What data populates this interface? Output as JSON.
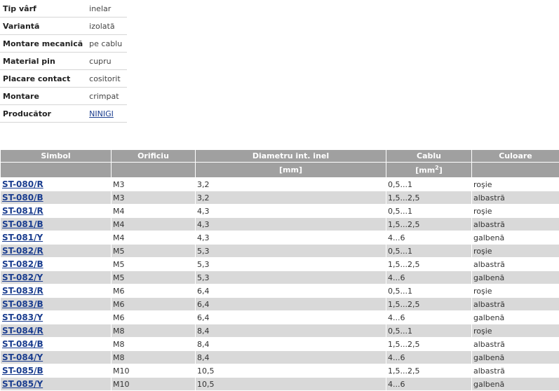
{
  "specs": [
    {
      "label": "Tip vârf",
      "value": "inelar"
    },
    {
      "label": "Variantă",
      "value": "izolată"
    },
    {
      "label": "Montare mecanică",
      "value": "pe cablu"
    },
    {
      "label": "Material pin",
      "value": "cupru"
    },
    {
      "label": "Placare contact",
      "value": "cositorit"
    },
    {
      "label": "Montare",
      "value": "crimpat"
    },
    {
      "label": "Producător",
      "value": "NINIGI"
    }
  ],
  "table": {
    "headers": [
      "Simbol",
      "Orificiu",
      "Diametru int. inel",
      "Cablu",
      "Culoare"
    ],
    "units": {
      "diameter": "[mm]",
      "cable_base": "[mm",
      "cable_sup": "2",
      "cable_end": "]"
    },
    "rows": [
      [
        "ST-080/R",
        "M3",
        "3,2",
        "0,5...1",
        "roşie"
      ],
      [
        "ST-080/B",
        "M3",
        "3,2",
        "1,5...2,5",
        "albastră"
      ],
      [
        "ST-081/R",
        "M4",
        "4,3",
        "0,5...1",
        "roşie"
      ],
      [
        "ST-081/B",
        "M4",
        "4,3",
        "1,5...2,5",
        "albastră"
      ],
      [
        "ST-081/Y",
        "M4",
        "4,3",
        "4...6",
        "galbenă"
      ],
      [
        "ST-082/R",
        "M5",
        "5,3",
        "0,5...1",
        "roşie"
      ],
      [
        "ST-082/B",
        "M5",
        "5,3",
        "1,5...2,5",
        "albastră"
      ],
      [
        "ST-082/Y",
        "M5",
        "5,3",
        "4...6",
        "galbenă"
      ],
      [
        "ST-083/R",
        "M6",
        "6,4",
        "0,5...1",
        "roşie"
      ],
      [
        "ST-083/B",
        "M6",
        "6,4",
        "1,5...2,5",
        "albastră"
      ],
      [
        "ST-083/Y",
        "M6",
        "6,4",
        "4...6",
        "galbenă"
      ],
      [
        "ST-084/R",
        "M8",
        "8,4",
        "0,5...1",
        "roşie"
      ],
      [
        "ST-084/B",
        "M8",
        "8,4",
        "1,5...2,5",
        "albastră"
      ],
      [
        "ST-084/Y",
        "M8",
        "8,4",
        "4...6",
        "galbenă"
      ],
      [
        "ST-085/B",
        "M10",
        "10,5",
        "1,5...2,5",
        "albastră"
      ],
      [
        "ST-085/Y",
        "M10",
        "10,5",
        "4...6",
        "galbenă"
      ]
    ]
  },
  "colors": {
    "header_bg": "#a0a0a0",
    "stripe_bg": "#d9d9d9",
    "link": "#1a3d8f"
  }
}
